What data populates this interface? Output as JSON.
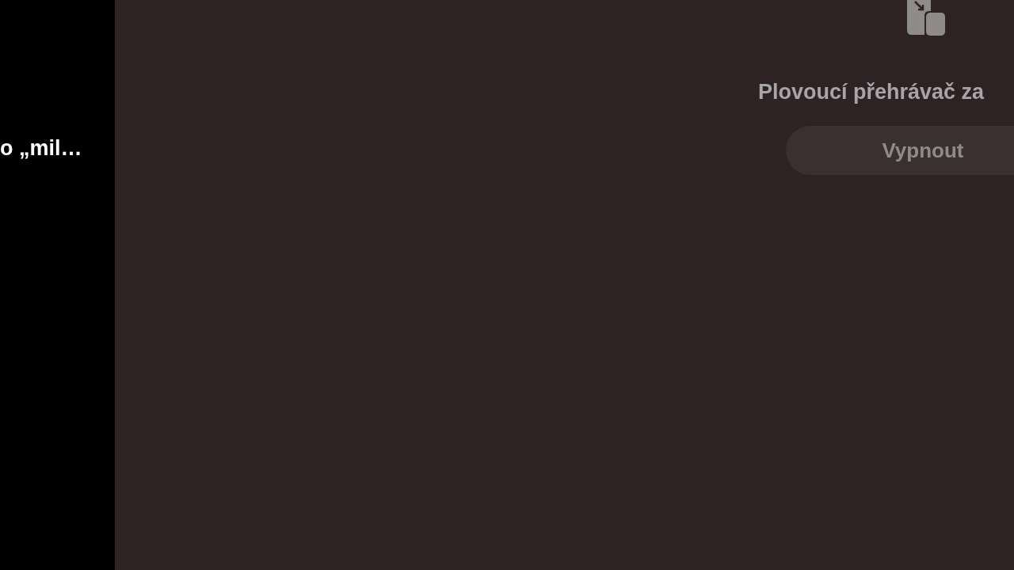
{
  "sidebar": {
    "video_title": "o „mil…"
  },
  "panel": {
    "title": "Plovoucí přehrávač za",
    "button": "Vypnout"
  }
}
